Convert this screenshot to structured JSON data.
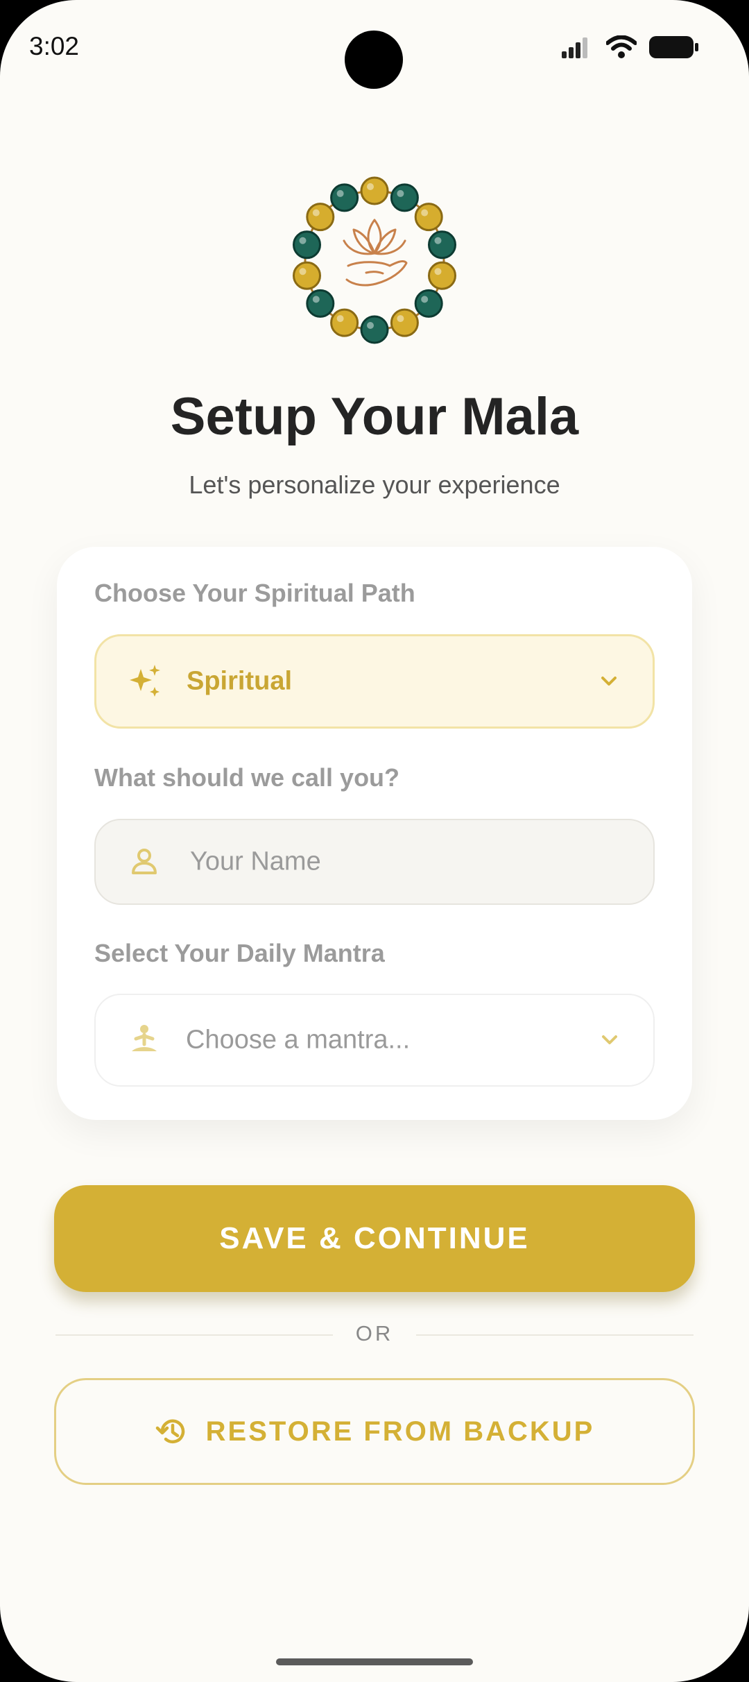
{
  "status_bar": {
    "time": "3:02"
  },
  "header": {
    "title": "Setup Your Mala",
    "subtitle": "Let's personalize your experience"
  },
  "form": {
    "path": {
      "label": "Choose Your Spiritual Path",
      "value": "Spiritual",
      "icon": "sparkles-icon"
    },
    "name": {
      "label": "What should we call you?",
      "placeholder": "Your Name",
      "icon": "person-icon"
    },
    "mantra": {
      "label": "Select Your Daily Mantra",
      "placeholder": "Choose a mantra...",
      "icon": "meditation-icon"
    }
  },
  "actions": {
    "save_label": "SAVE & CONTINUE",
    "or_label": "OR",
    "restore_label": "RESTORE FROM BACKUP",
    "restore_icon": "history-icon"
  },
  "colors": {
    "accent": "#d4b035",
    "bead_gold": "#d6ad2e",
    "bead_green": "#1e6657",
    "lotus": "#c8814b",
    "background": "#fcfbf7"
  }
}
